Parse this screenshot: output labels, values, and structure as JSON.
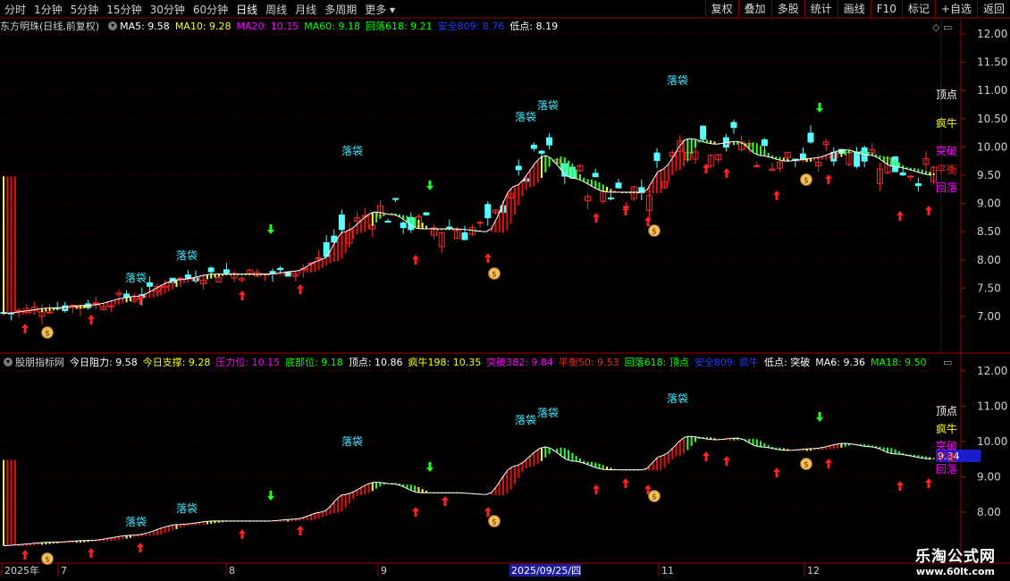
{
  "toolbar": {
    "left": [
      "分时",
      "1分钟",
      "5分钟",
      "15分钟",
      "30分钟",
      "60分钟",
      "日线",
      "周线",
      "月线",
      "多周期",
      "更多"
    ],
    "right": [
      "复权",
      "叠加",
      "多股",
      "统计",
      "画线",
      "F10",
      "标记",
      "+自选",
      "返回"
    ],
    "active_index": 6
  },
  "main_legend": {
    "title": "东方明珠(日线,前复权)",
    "items": [
      {
        "text": "MA5: 9.58",
        "color": "#ffffff"
      },
      {
        "text": "MA10: 9.28",
        "color": "#ffff00"
      },
      {
        "text": "MA20: 10.15",
        "color": "#ff00ff"
      },
      {
        "text": "MA60: 9.18",
        "color": "#00ff00"
      },
      {
        "text": "回落618: 9.21",
        "color": "#00ff00"
      },
      {
        "text": "安全809: 8.76",
        "color": "#1e3cff"
      },
      {
        "text": "低点: 8.19",
        "color": "#ffffff"
      }
    ]
  },
  "sub_legend": {
    "title": "股朋指标网",
    "items": [
      {
        "text": "今日阻力: 9.58",
        "color": "#ffffff"
      },
      {
        "text": "今日支撑: 9.28",
        "color": "#ffff00"
      },
      {
        "text": "压力位: 10.15",
        "color": "#ff00ff"
      },
      {
        "text": "底部位: 9.18",
        "color": "#00ff00"
      },
      {
        "text": "顶点: 10.86",
        "color": "#ffffff"
      },
      {
        "text": "疯牛198: 10.35",
        "color": "#ffff00"
      },
      {
        "text": "突破382: 9.84",
        "color": "#ff00ff"
      },
      {
        "text": "平衡50: 9.53",
        "color": "#ff2020"
      },
      {
        "text": "回落618: 顶点",
        "color": "#00ff00"
      },
      {
        "text": "安全809: 疯牛",
        "color": "#1e3cff"
      },
      {
        "text": "低点: 突破",
        "color": "#ffffff"
      },
      {
        "text": "MA6: 9.36",
        "color": "#ffffff"
      },
      {
        "text": "MA18: 9.50",
        "color": "#00ff00"
      }
    ]
  },
  "main_axis": {
    "ticks": [
      "12.00",
      "11.50",
      "11.00",
      "10.50",
      "10.00",
      "9.50",
      "9.00",
      "8.50",
      "8.00",
      "7.50",
      "7.00"
    ]
  },
  "sub_axis": {
    "ticks": [
      "12.00",
      "11.00",
      "10.00",
      "9.00",
      "8.00"
    ],
    "current": "9.34"
  },
  "levels_main": [
    {
      "text": "顶点",
      "color": "#ffffff"
    },
    {
      "text": "疯牛",
      "color": "#ffff00"
    },
    {
      "text": "突破",
      "color": "#ff00ff"
    },
    {
      "text": "平衡",
      "color": "#ff2020"
    },
    {
      "text": "回落",
      "color": "#ff00ff"
    }
  ],
  "levels_sub": [
    {
      "text": "顶点",
      "color": "#ffffff"
    },
    {
      "text": "疯牛",
      "color": "#ffff00"
    },
    {
      "text": "突破",
      "color": "#ff00ff"
    },
    {
      "text": "平衡",
      "color": "#ff2020"
    },
    {
      "text": "回落",
      "color": "#ff00ff"
    }
  ],
  "annotation_label": "落袋",
  "money_icon": "money-bag-icon",
  "date_axis": {
    "labels": [
      "2025年",
      "7",
      "8",
      "9",
      "11",
      "12"
    ],
    "highlight": "2025/09/25/四"
  },
  "watermark": {
    "line1": "乐淘公式网",
    "line2": "www.60lt.com"
  },
  "colors": {
    "up": "#ff2a2a",
    "down": "#54ffff",
    "band_red": "#e01010",
    "band_yellow": "#ffff30",
    "band_green": "#30ff30",
    "arrow_up": "#ff2020",
    "arrow_down": "#20ff20",
    "label": "#40e8ff"
  }
}
